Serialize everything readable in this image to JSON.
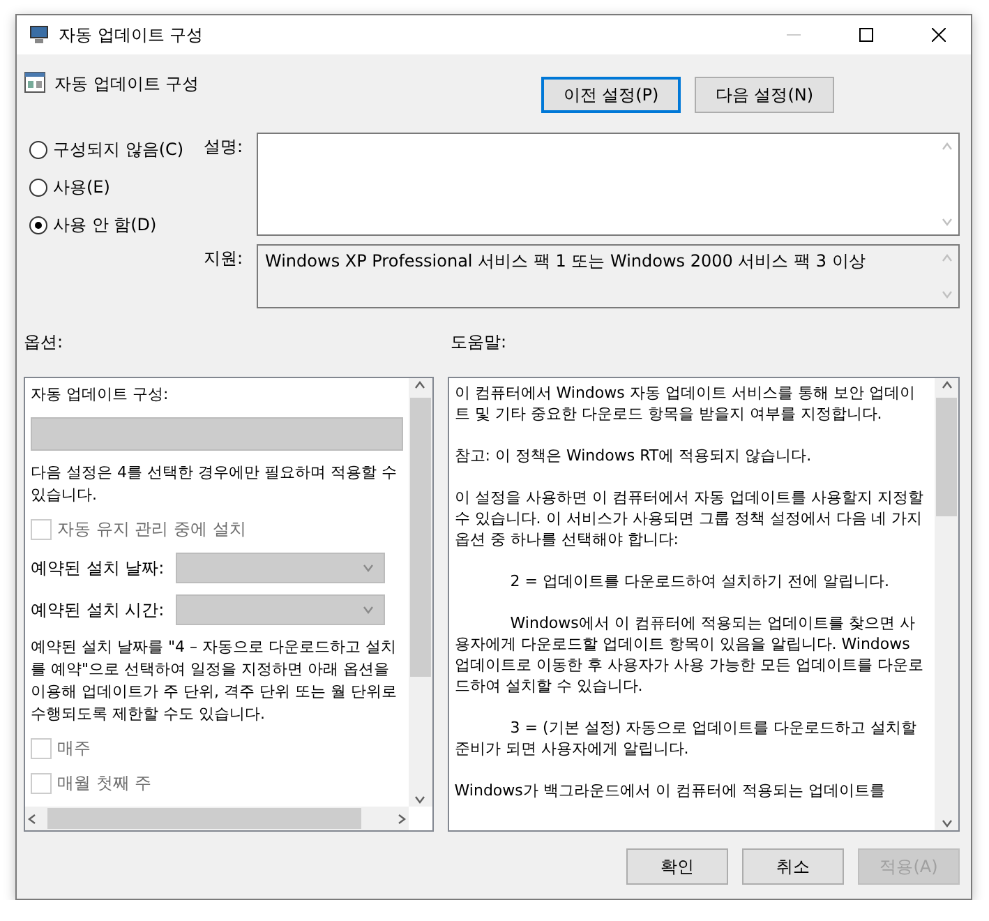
{
  "window": {
    "title": "자동 업데이트 구성"
  },
  "header": {
    "title": "자동 업데이트 구성",
    "buttons": [
      {
        "label": "이전 설정(P)",
        "focused": true
      },
      {
        "label": "다음 설정(N)",
        "focused": false
      }
    ]
  },
  "state_options": [
    {
      "label": "구성되지 않음(C)",
      "selected": false
    },
    {
      "label": "사용(E)",
      "selected": false
    },
    {
      "label": "사용 안 함(D)",
      "selected": true
    }
  ],
  "comment": {
    "label": "설명:"
  },
  "supported_on": {
    "label": "지원:",
    "value": "Windows XP Professional 서비스 팩 1 또는 Windows 2000 서비스 팩 3 이상"
  },
  "options": {
    "label": "옵션:",
    "items": [
      {
        "kind": "text",
        "text": "자동 업데이트 구성:"
      },
      {
        "kind": "combo",
        "disabled": true
      },
      {
        "kind": "text",
        "text": "다음 설정은 4를 선택한 경우에만 필요하며 적용할 수 있습니다."
      },
      {
        "kind": "checkbox",
        "label": "자동 유지 관리 중에 설치",
        "checked": false,
        "disabled": true
      },
      {
        "kind": "select",
        "label": "예약된 설치 날짜:",
        "disabled": true
      },
      {
        "kind": "select",
        "label": "예약된 설치 시간:",
        "disabled": true
      },
      {
        "kind": "text",
        "text": "예약된 설치 날짜를 \"4 – 자동으로 다운로드하고 설치를 예약\"으로 선택하여 일정을 지정하면 아래 옵션을 이용해 업데이트가 주 단위, 격주 단위 또는 월 단위로 수행되도록 제한할 수도 있습니다."
      },
      {
        "kind": "checkbox",
        "label": "매주",
        "checked": false,
        "disabled": true
      },
      {
        "kind": "checkbox",
        "label": "매월 첫째 주",
        "checked": false,
        "disabled": true
      }
    ]
  },
  "help": {
    "label": "도움말:",
    "paragraphs": [
      {
        "text": "이 컴퓨터에서 Windows 자동 업데이트 서비스를 통해 보안 업데이트 및 기타 중요한 다운로드 항목을 받을지 여부를 지정합니다.",
        "indent": false
      },
      {
        "text": "참고: 이 정책은 Windows RT에 적용되지 않습니다.",
        "indent": false
      },
      {
        "text": "이 설정을 사용하면 이 컴퓨터에서 자동 업데이트를 사용할지 지정할 수 있습니다. 이 서비스가 사용되면 그룹 정책 설정에서 다음 네 가지 옵션 중 하나를 선택해야 합니다:",
        "indent": false
      },
      {
        "text": "2 = 업데이트를 다운로드하여 설치하기 전에 알립니다.",
        "indent": true
      },
      {
        "text": "Windows에서 이 컴퓨터에 적용되는 업데이트를 찾으면 사용자에게 다운로드할 업데이트 항목이 있음을 알립니다. Windows 업데이트로 이동한 후 사용자가 사용 가능한 모든 업데이트를 다운로드하여 설치할 수 있습니다.",
        "indent": true
      },
      {
        "text": "3 = (기본 설정) 자동으로 업데이트를 다운로드하고 설치할 준비가 되면 사용자에게 알립니다.",
        "indent": true
      },
      {
        "text": "Windows가 백그라운드에서 이 컴퓨터에 적용되는 업데이트를",
        "indent": false
      }
    ]
  },
  "footer_buttons": [
    {
      "label": "확인",
      "disabled": false
    },
    {
      "label": "취소",
      "disabled": false
    },
    {
      "label": "적용(A)",
      "disabled": true
    }
  ]
}
